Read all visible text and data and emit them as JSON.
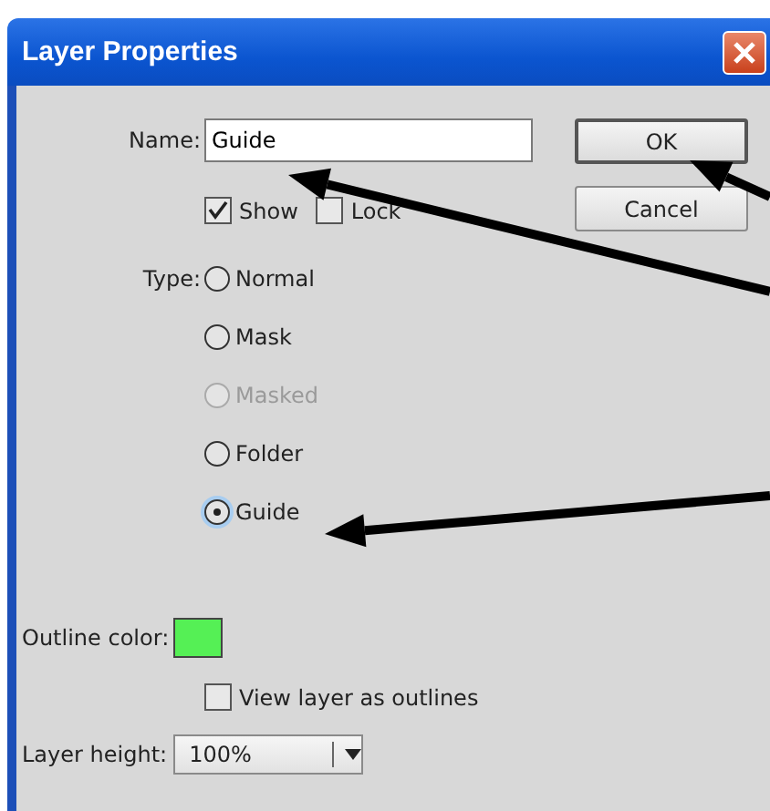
{
  "window": {
    "title": "Layer Properties"
  },
  "name_field": {
    "label": "Name:",
    "value": "Guide"
  },
  "flags": [
    {
      "label": "Show",
      "checked": true
    },
    {
      "label": "Lock",
      "checked": false
    }
  ],
  "type": {
    "label": "Type:",
    "options": [
      {
        "label": "Normal",
        "selected": false,
        "disabled": false
      },
      {
        "label": "Mask",
        "selected": false,
        "disabled": false
      },
      {
        "label": "Masked",
        "selected": false,
        "disabled": true
      },
      {
        "label": "Folder",
        "selected": false,
        "disabled": false
      },
      {
        "label": "Guide",
        "selected": true,
        "disabled": false
      }
    ]
  },
  "outline_color": {
    "label": "Outline color:",
    "color": "#55f055"
  },
  "view_outlines": {
    "label": "View layer as outlines",
    "checked": false
  },
  "layer_height": {
    "label": "Layer height:",
    "value": "100%"
  },
  "buttons": [
    {
      "label": "OK",
      "default": true
    },
    {
      "label": "Cancel",
      "default": false
    }
  ]
}
